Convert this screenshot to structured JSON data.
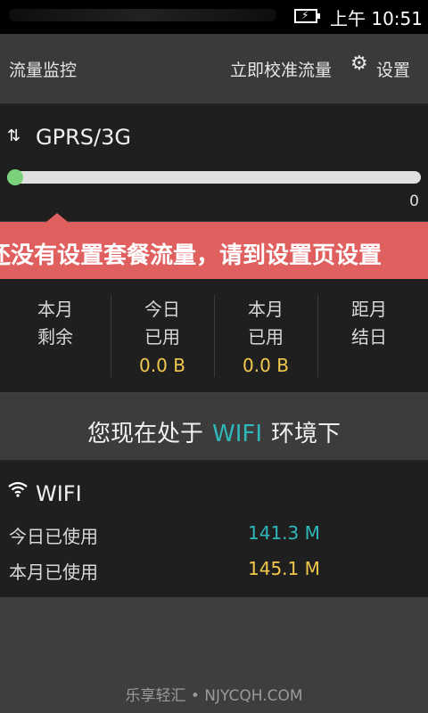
{
  "status_bar": {
    "time": "上午 10:51"
  },
  "header": {
    "title": "流量监控",
    "calibrate_label": "立即校准流量",
    "settings_label": "设置"
  },
  "gprs": {
    "name": "GPRS/3G",
    "usage_fraction": 0,
    "max_label": "0"
  },
  "banner": {
    "text": "还没有设置套餐流量，请到设置页设置"
  },
  "stats": {
    "columns": [
      {
        "line1": "本月",
        "line2": "剩余",
        "value": ""
      },
      {
        "line1": "今日",
        "line2": "已用",
        "value": "0.0 B"
      },
      {
        "line1": "本月",
        "line2": "已用",
        "value": "0.0 B"
      },
      {
        "line1": "距月",
        "line2": "结日",
        "value": ""
      }
    ]
  },
  "wifi_notice": {
    "prefix": "您现在处于",
    "highlight": "WIFI",
    "suffix": "环境下"
  },
  "wifi": {
    "name": "WIFI",
    "today_label": "今日已使用",
    "today_value": "141.3 M",
    "month_label": "本月已使用",
    "month_value": "145.1 M"
  },
  "footer": {
    "text": "乐享轻汇 • NJYCQH.COM"
  },
  "colors": {
    "accent": "#2fb8ba",
    "value_yellow": "#f2c94c",
    "banner": "#e06060",
    "progress_dot": "#7ad27a"
  }
}
